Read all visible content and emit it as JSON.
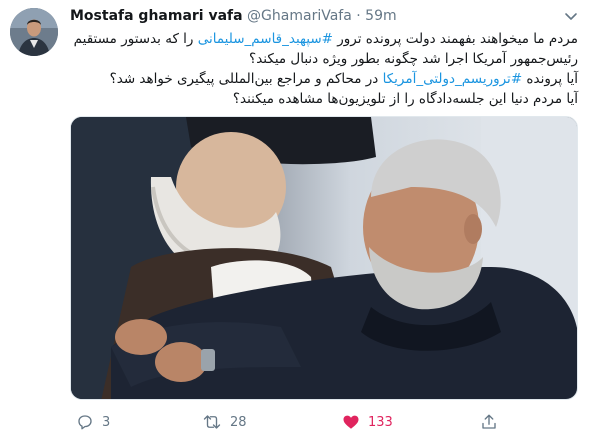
{
  "tweet": {
    "display_name": "Mostafa ghamari vafa",
    "handle": "@GhamariVafa",
    "separator": "·",
    "time": "59m",
    "text_lines": [
      {
        "before": "مردم ما میخواهند بفهمند دولت پرونده ترور ",
        "hashtag": "#سپهبد_قاسم_سلیمانی",
        "after": " را که بدستور مستقیم"
      },
      {
        "before": "رئیس‌جمهور آمریکا اجرا شد چگونه بطور ویژه دنبال میکند؟",
        "hashtag": "",
        "after": ""
      },
      {
        "before": "آیا پرونده ",
        "hashtag": "#تروریسم_دولتی_آمریکا",
        "after": " در محاکم و مراجع بین‌المللی پیگیری خواهد شد؟"
      },
      {
        "before": "آیا مردم دنیا این جلسه‌دادگاه را از تلویزیون‌ها مشاهده میکنند؟",
        "hashtag": "",
        "after": ""
      }
    ]
  },
  "actions": {
    "reply_count": "3",
    "retweet_count": "28",
    "like_count": "133",
    "like_liked": true
  },
  "colors": {
    "link": "#1b95e0",
    "muted": "#657786",
    "like": "#e0245e"
  },
  "icons": [
    "caret-down-icon",
    "reply-icon",
    "retweet-icon",
    "heart-icon",
    "share-icon"
  ]
}
